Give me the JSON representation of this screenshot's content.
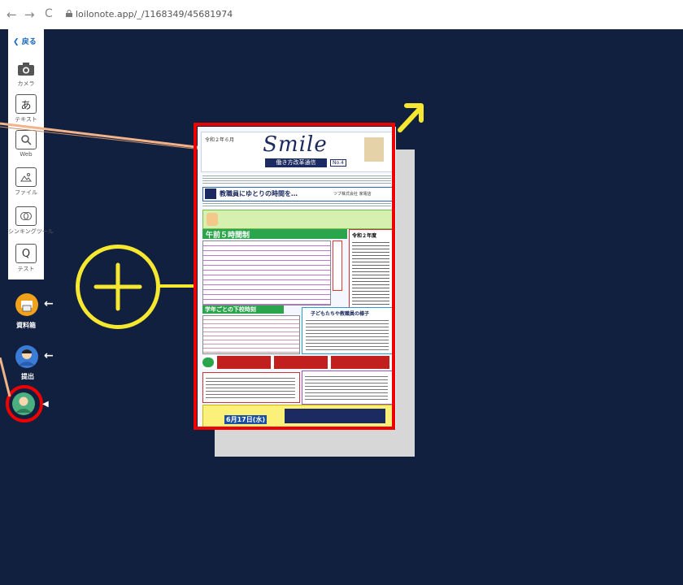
{
  "browser": {
    "url": "loilonote.app/_/1168349/45681974"
  },
  "toolbar": {
    "back_label": "戻る",
    "items": [
      {
        "name": "camera",
        "label": "カメラ",
        "icon": "camera-icon"
      },
      {
        "name": "text",
        "label": "テキスト",
        "icon": "text-a-icon",
        "glyph": "あ"
      },
      {
        "name": "web",
        "label": "Web",
        "icon": "search-icon"
      },
      {
        "name": "file",
        "label": "ファイル",
        "icon": "file-icon"
      },
      {
        "name": "thinking-tool",
        "label": "シンキングツール",
        "icon": "circles-icon"
      },
      {
        "name": "test",
        "label": "テスト",
        "icon": "test-icon",
        "glyph": "Q"
      }
    ]
  },
  "side_buttons": [
    {
      "name": "materials",
      "label": "資料箱",
      "icon": "printer-icon"
    },
    {
      "name": "submit",
      "label": "提出",
      "icon": "person-icon"
    },
    {
      "name": "share",
      "label": "",
      "icon": "group-icon"
    }
  ],
  "document": {
    "header_left": "令和２年６月",
    "title": "Smile",
    "subtitle": "働き方改革通信",
    "issue": "No.4",
    "topic_title": "教職員にゆとりの時間を…",
    "school_tag": "ツブ株式会社 家電店",
    "section_timetable": "午前５時間制",
    "section_lunch": "令和２年度",
    "section_schedule": "学年ごとの下校時刻",
    "section_kids": "子どもたちや教職員の様子",
    "footer_banner": "6月17日(水)"
  },
  "colors": {
    "canvas_bg": "#12203f",
    "highlight_red": "#ee0000",
    "yellow": "#f6e830",
    "orange_pointer": "#f2b38a"
  }
}
